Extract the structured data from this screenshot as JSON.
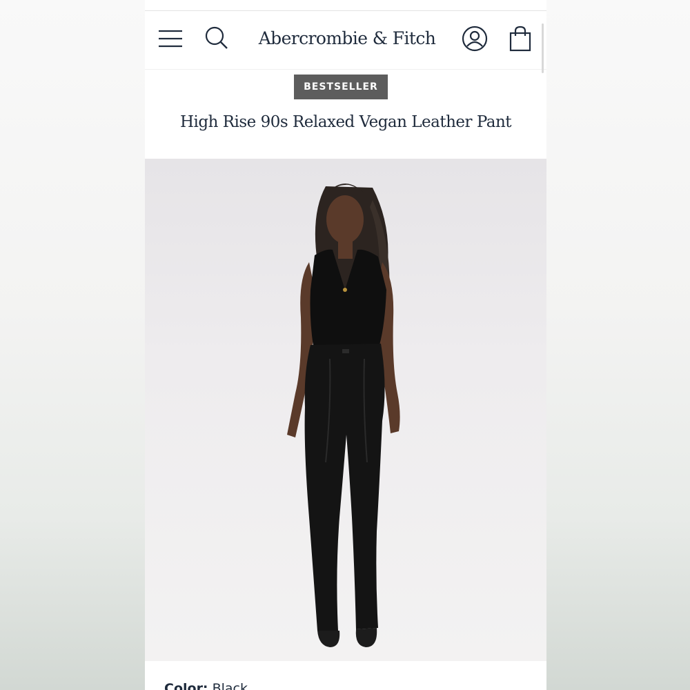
{
  "header": {
    "brand": "Abercrombie & Fitch",
    "icons": [
      "menu-icon",
      "search-icon",
      "account-icon",
      "shopping-bag-icon"
    ]
  },
  "badge": "BESTSELLER",
  "product": {
    "title": "High Rise 90s Relaxed Vegan Leather Pant",
    "image_alt": "Model wearing black top and black vegan leather pants",
    "color_label": "Color:",
    "color_value": "Black"
  },
  "colors": {
    "text": "#1f2b3c",
    "badge_bg": "#5d5d5d",
    "image_bg": "#ebe9eb"
  }
}
